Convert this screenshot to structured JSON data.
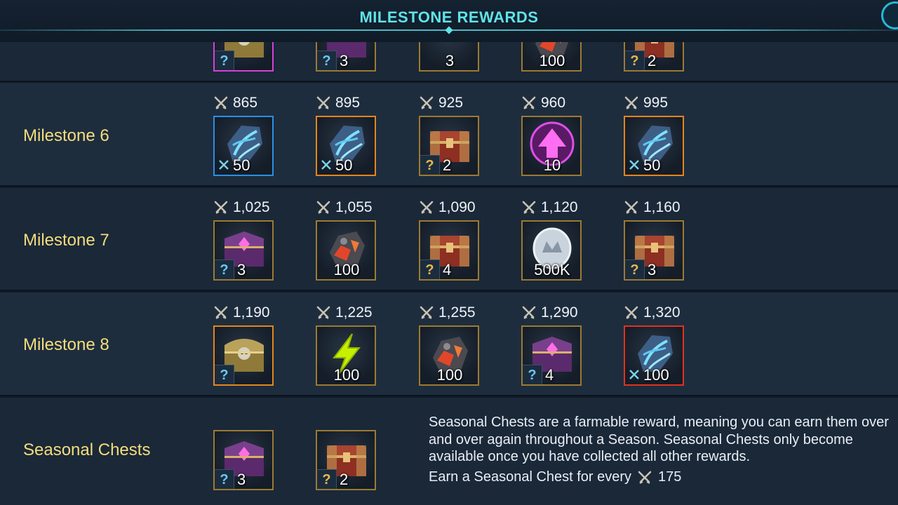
{
  "header": {
    "title": "MILESTONE REWARDS"
  },
  "partial_row": {
    "rewards": [
      {
        "art": "gold-chest-icon",
        "frame": "magenta",
        "badge": "?",
        "badge_color": "blue",
        "qty": ""
      },
      {
        "art": "purple-chest-icon",
        "frame": "gold",
        "badge": "?",
        "badge_color": "blue",
        "qty": "3"
      },
      {
        "art": "blue-swirl-icon",
        "frame": "gold",
        "badge": "",
        "badge_color": "",
        "qty": "3"
      },
      {
        "art": "meteor-shard-icon",
        "frame": "gold",
        "badge": "",
        "badge_color": "",
        "qty": "100"
      },
      {
        "art": "red-chest-icon",
        "frame": "gold",
        "badge": "?",
        "badge_color": "gold",
        "qty": "2"
      }
    ]
  },
  "milestones": [
    {
      "label": "Milestone 6",
      "rewards": [
        {
          "cost": "865",
          "art": "blue-shard-icon",
          "frame": "blue",
          "badge": "x",
          "badge_color": "",
          "qty": "50"
        },
        {
          "cost": "895",
          "art": "blue-shard-icon",
          "frame": "orange",
          "badge": "x",
          "badge_color": "",
          "qty": "50"
        },
        {
          "cost": "925",
          "art": "red-chest-icon",
          "frame": "gold",
          "badge": "?",
          "badge_color": "gold",
          "qty": "2"
        },
        {
          "cost": "960",
          "art": "rank-up-icon",
          "frame": "gold",
          "badge": "",
          "badge_color": "",
          "qty": "10"
        },
        {
          "cost": "995",
          "art": "blue-shard-icon",
          "frame": "orange",
          "badge": "x",
          "badge_color": "",
          "qty": "50"
        }
      ]
    },
    {
      "label": "Milestone 7",
      "rewards": [
        {
          "cost": "1,025",
          "art": "purple-chest-icon",
          "frame": "gold",
          "badge": "?",
          "badge_color": "blue",
          "qty": "3"
        },
        {
          "cost": "1,055",
          "art": "meteor-shard-icon",
          "frame": "gold",
          "badge": "",
          "badge_color": "",
          "qty": "100"
        },
        {
          "cost": "1,090",
          "art": "red-chest-icon",
          "frame": "gold",
          "badge": "?",
          "badge_color": "gold",
          "qty": "4"
        },
        {
          "cost": "1,120",
          "art": "silver-coin-icon",
          "frame": "gold",
          "badge": "",
          "badge_color": "",
          "qty": "500K"
        },
        {
          "cost": "1,160",
          "art": "red-chest-icon",
          "frame": "gold",
          "badge": "?",
          "badge_color": "gold",
          "qty": "3"
        }
      ]
    },
    {
      "label": "Milestone 8",
      "rewards": [
        {
          "cost": "1,190",
          "art": "gold-chest-icon",
          "frame": "orange",
          "badge": "?",
          "badge_color": "blue",
          "qty": ""
        },
        {
          "cost": "1,225",
          "art": "energy-bolt-icon",
          "frame": "gold",
          "badge": "",
          "badge_color": "",
          "qty": "100"
        },
        {
          "cost": "1,255",
          "art": "meteor-shard-icon",
          "frame": "gold",
          "badge": "",
          "badge_color": "",
          "qty": "100"
        },
        {
          "cost": "1,290",
          "art": "purple-chest-icon",
          "frame": "gold",
          "badge": "?",
          "badge_color": "blue",
          "qty": "4"
        },
        {
          "cost": "1,320",
          "art": "blue-shard-icon",
          "frame": "red",
          "badge": "x",
          "badge_color": "",
          "qty": "100"
        }
      ]
    }
  ],
  "seasonal": {
    "label": "Seasonal Chests",
    "rewards": [
      {
        "art": "purple-chest-icon",
        "frame": "gold",
        "badge": "?",
        "badge_color": "blue",
        "qty": "3"
      },
      {
        "art": "red-chest-icon",
        "frame": "gold",
        "badge": "?",
        "badge_color": "gold",
        "qty": "2"
      }
    ],
    "description": "Seasonal Chests are a farmable reward, meaning you can earn them over and over again throughout a Season. Seasonal Chests only become available once you have collected all other rewards.",
    "earn_text": "Earn a Seasonal Chest for every",
    "earn_cost": "175"
  },
  "colors": {
    "title": "#5fe3e8",
    "label": "#f4dd7c",
    "row_bg": "#1a2838",
    "row_alt_bg": "#1e2d3e",
    "frame_gold": "#9c7a32",
    "frame_blue": "#2b8fe3",
    "frame_orange": "#e4851c",
    "frame_magenta": "#d63fd9",
    "frame_red": "#e0321f"
  }
}
